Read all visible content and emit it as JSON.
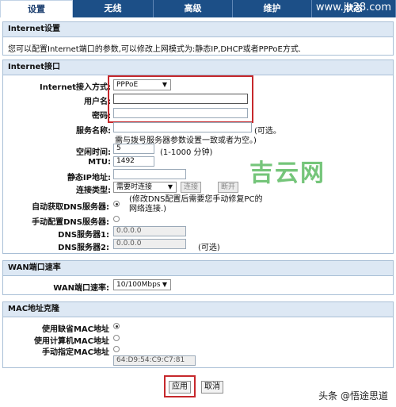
{
  "tabs": [
    "设置",
    "无线",
    "高级",
    "维护",
    "状态"
  ],
  "watermark_top": "www.jb28.com",
  "internet_settings": {
    "title": "Internet设置",
    "desc": "您可以配置Internet端口的参数,可以修改上网模式为:静态IP,DHCP或者PPPoE方式."
  },
  "internet_port": {
    "title": "Internet接口",
    "access_mode_label": "Internet接入方式:",
    "access_mode_value": "PPPoE",
    "username_label": "用户名:",
    "username_value": "",
    "password_label": "密码:",
    "password_value": "",
    "service_name_label": "服务名称:",
    "service_name_value": "",
    "service_name_optional": "(可选。",
    "service_name_hint": "需与拨号服务器参数设置一致或者为空。)",
    "idle_time_label": "空闲时间:",
    "idle_time_value": "5",
    "idle_time_hint": "(1-1000 分钟)",
    "mtu_label": "MTU:",
    "mtu_value": "1492",
    "static_ip_label": "静态IP地址:",
    "static_ip_value": "",
    "conn_type_label": "连接类型:",
    "conn_type_value": "需要时连接",
    "connect_btn": "连接",
    "disconnect_btn": "断开",
    "auto_dns_label": "自动获取DNS服务器:",
    "auto_dns_hint": "(修改DNS配置后需要您手动修复PC的网络连接.)",
    "manual_dns_label": "手动配置DNS服务器:",
    "dns1_label": "DNS服务器1:",
    "dns1_value": "0.0.0.0",
    "dns2_label": "DNS服务器2:",
    "dns2_value": "0.0.0.0",
    "dns2_optional": "(可选)"
  },
  "wan_speed": {
    "title": "WAN端口速率",
    "label": "WAN端口速率:",
    "value": "10/100Mbps"
  },
  "mac_clone": {
    "title": "MAC地址克隆",
    "default_label": "使用缺省MAC地址",
    "pc_label": "使用计算机MAC地址",
    "manual_label": "手动指定MAC地址",
    "mac_value": "64:D9:54:C9:C7:81"
  },
  "buttons": {
    "apply": "应用",
    "cancel": "取消"
  },
  "watermark_center": "吉云网",
  "footer": "头条 @悟途思道",
  "colors": {
    "tab_bar": "#1c4f87",
    "section_header": "#dde8f4",
    "highlight": "#c6282c",
    "watermark": "#5dbb63"
  }
}
